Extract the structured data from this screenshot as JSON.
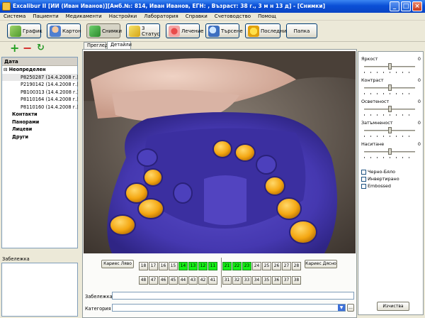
{
  "window": {
    "title": "Excalibur II [ИИ (Иван Иванов)][Амб.№: 814, Иван Иванов, ЕГН: , Възраст: 38 г., 3 м н 13 д] - [Снимки]"
  },
  "menu": [
    "Система",
    "Пациенти",
    "Медикаменти",
    "Настройки",
    "Лаборатория",
    "Справки",
    "Счетоводство",
    "Помощ"
  ],
  "toolbar": [
    {
      "label": "График",
      "icon": "calendar-icon"
    },
    {
      "label": "Картон",
      "icon": "person-card-icon"
    },
    {
      "label": "Снимки",
      "icon": "pictures-icon"
    },
    {
      "label": "3 Статус",
      "icon": "status-pen-icon"
    },
    {
      "label": "Лечение",
      "icon": "treatment-icon"
    },
    {
      "label": "Търсене",
      "icon": "search-icon"
    },
    {
      "label": "Последни",
      "icon": "star-icon"
    },
    {
      "label": "Папка",
      "icon": ""
    }
  ],
  "left": {
    "header": "Дата",
    "root": "Неопределен",
    "items": [
      "P8250287 (14.4.2008 г.)",
      "P2190142 (14.4.2008 г.)",
      "PB100313 (14.4.2008 г.)",
      "P8110164 (14.4.2008 г.)",
      "P8110160 (14.4.2008 г.)"
    ],
    "groups": [
      "Контакти",
      "Панорами",
      "Лицеви",
      "Други"
    ],
    "note_label": "Забележка"
  },
  "tabs": [
    "Преглед",
    "Детайли"
  ],
  "adjust": [
    {
      "label": "Яркост",
      "value": "0"
    },
    {
      "label": "Контраст",
      "value": "0"
    },
    {
      "label": "Осветеност",
      "value": "0"
    },
    {
      "label": "Затъмненост",
      "value": "0"
    },
    {
      "label": "Наситане",
      "value": "0"
    }
  ],
  "checks": [
    "Черно-Бяло",
    "Инвертирано",
    "Embossed"
  ],
  "teeth": {
    "upper_left": [
      "18",
      "17",
      "16",
      "15",
      "14",
      "13",
      "12",
      "11"
    ],
    "upper_right": [
      "21",
      "22",
      "23",
      "24",
      "25",
      "26",
      "27",
      "28"
    ],
    "lower_left": [
      "48",
      "47",
      "46",
      "45",
      "44",
      "43",
      "42",
      "41"
    ],
    "lower_right": [
      "31",
      "32",
      "33",
      "34",
      "35",
      "36",
      "37",
      "38"
    ],
    "highlighted": [
      "14",
      "13",
      "12",
      "11",
      "21",
      "22",
      "23"
    ]
  },
  "buttons": {
    "caries_left": "Кариес Ляво",
    "caries_right": "Кариес Дясно",
    "clear": "Изчиства",
    "browse": "..."
  },
  "form": {
    "note_label": "Забележка",
    "category_label": "Категория"
  }
}
